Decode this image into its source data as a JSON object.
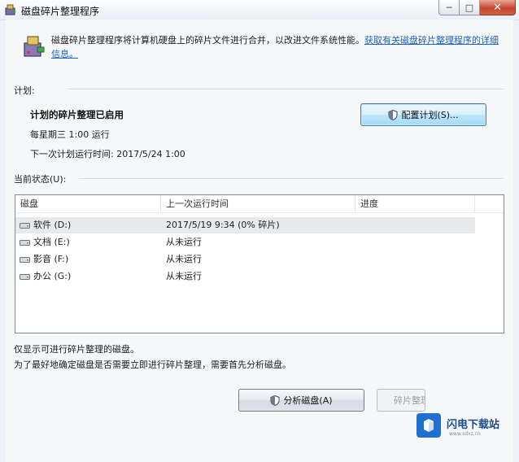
{
  "window": {
    "title": "磁盘碎片整理程序",
    "controls": {
      "minimize": "─",
      "maximize": "□",
      "close": "✕"
    }
  },
  "description": {
    "text": "磁盘碎片整理程序将计算机硬盘上的碎片文件进行合并，以改进文件系统性能。",
    "link": "获取有关磁盘碎片整理程序的详细信息。"
  },
  "schedule": {
    "section_label": "计划:",
    "title": "计划的碎片整理已启用",
    "frequency": "每星期三 1:00 运行",
    "next_run": "下一次计划运行时间: 2017/5/24 1:00",
    "configure_button": "配置计划(S)..."
  },
  "status": {
    "section_label": "当前状态(U):",
    "columns": [
      "磁盘",
      "上一次运行时间",
      "进度"
    ],
    "disks": [
      {
        "name": "软件 (D:)",
        "last_run": "2017/5/19 9:34 (0% 碎片)",
        "progress": ""
      },
      {
        "name": "文档 (E:)",
        "last_run": "从未运行",
        "progress": ""
      },
      {
        "name": "影音 (F:)",
        "last_run": "从未运行",
        "progress": ""
      },
      {
        "name": "办公 (G:)",
        "last_run": "从未运行",
        "progress": ""
      }
    ]
  },
  "footer": {
    "note1": "仅显示可进行碎片整理的磁盘。",
    "note2": "为了最好地确定磁盘是否需要立即进行碎片整理，需要首先分析磁盘。",
    "analyze_button": "分析磁盘(A)",
    "defrag_button": "碎片整理磁盘(D)"
  },
  "watermark": {
    "text": "闪电下载站",
    "sub": "www.sdxz.cn"
  },
  "colors": {
    "link": "#1b62c8",
    "accent": "#3c7fb1",
    "selected_row": "#e8e9eb"
  }
}
